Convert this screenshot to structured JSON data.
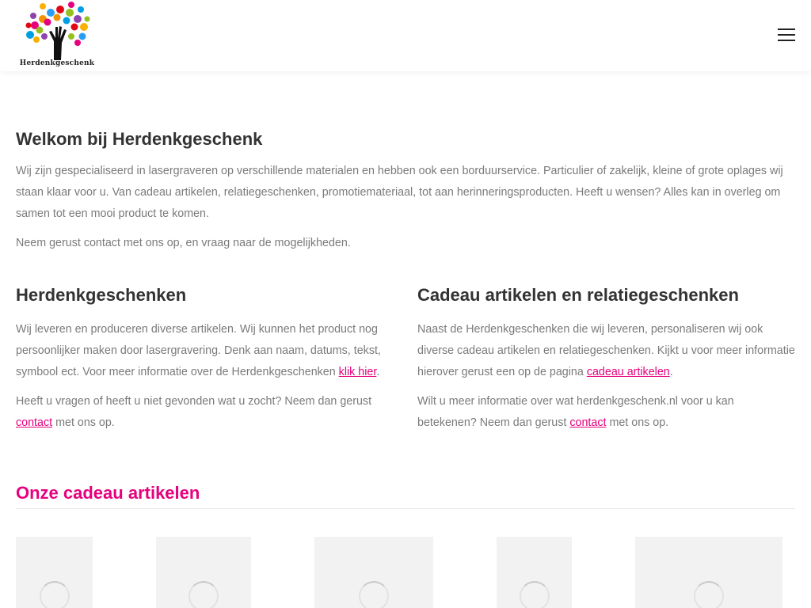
{
  "header": {
    "logo_text": "Herdenkgeschenk",
    "menu_icon": "hamburger-icon"
  },
  "welcome": {
    "title": "Welkom bij Herdenkgeschenk",
    "paragraph1": "Wij zijn gespecialiseerd in lasergraveren op verschillende materialen en hebben ook een borduurservice. Particulier of zakelijk, kleine of grote oplages wij staan klaar voor u. Van cadeau artikelen, relatiegeschenken, promotiemateriaal, tot aan herinneringsproducten. Heeft u wensen? Alles kan in overleg om samen tot een mooi product te komen.",
    "paragraph2": "Neem gerust contact met ons op, en vraag naar de mogelijkheden."
  },
  "left_column": {
    "title": "Herdenkgeschenken",
    "p1_text": "Wij leveren en produceren diverse artikelen. Wij kunnen het product nog persoonlijker maken door lasergravering. Denk aan naam, datums, tekst, symbool ect. Voor meer informatie over de Herdenkgeschenken ",
    "p1_link": "klik hier",
    "p1_end": ".",
    "p2_text": "Heeft u vragen of heeft u niet gevonden wat u zocht? Neem dan gerust ",
    "p2_link": "contact",
    "p2_end": " met ons op."
  },
  "right_column": {
    "title": "Cadeau artikelen en relatiegeschenken",
    "p1_text": "Naast de Herdenkgeschenken die wij leveren, personaliseren wij ook diverse cadeau artikelen en relatiegeschenken. Kijkt u voor meer informatie hierover gerust een op de pagina ",
    "p1_link": "cadeau artikelen",
    "p1_end": ".",
    "p2_text": "Wilt u meer informatie over wat herdenkgeschenk.nl voor u kan betekenen? Neem dan gerust ",
    "p2_link": "contact",
    "p2_end": " met ons op."
  },
  "products": {
    "title": "Onze cadeau artikelen"
  },
  "colors": {
    "accent": "#e6007e",
    "heading": "#333333",
    "body_text": "#7a7a7a"
  }
}
